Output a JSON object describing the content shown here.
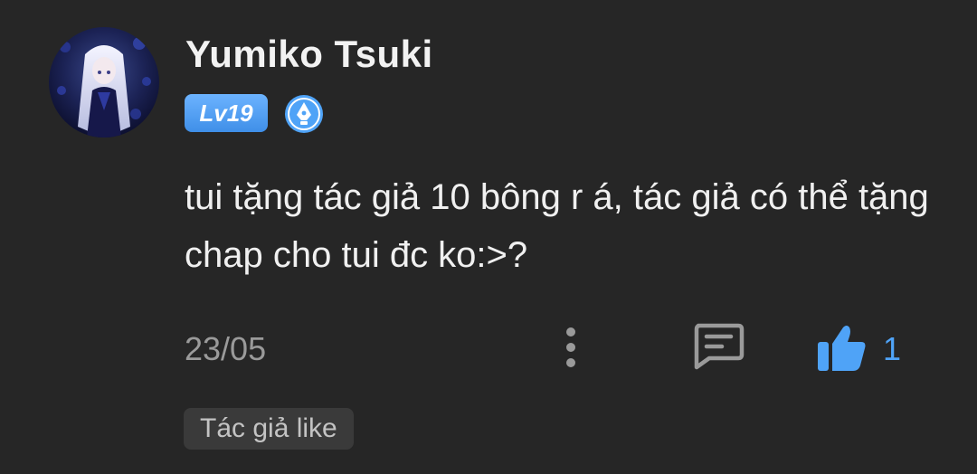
{
  "comment": {
    "user": {
      "name": "Yumiko Tsuki",
      "level": "Lv19",
      "avatar_icon": "anime-avatar-icon",
      "badge_icon": "quill-pen-badge-icon"
    },
    "text": "tui tặng tác giả 10 bông r á, tác giả có thể tặng chap cho tui đc ko:>?",
    "date": "23/05",
    "actions": {
      "more_icon": "more-vertical-icon",
      "reply_icon": "comment-icon",
      "like_icon": "thumbs-up-icon",
      "like_count": "1"
    },
    "tag": "Tác giả like"
  },
  "colors": {
    "background": "#262626",
    "accent_blue": "#4fa3f7",
    "muted_text": "#9a9a9a",
    "tag_background": "#3a3a3a"
  }
}
